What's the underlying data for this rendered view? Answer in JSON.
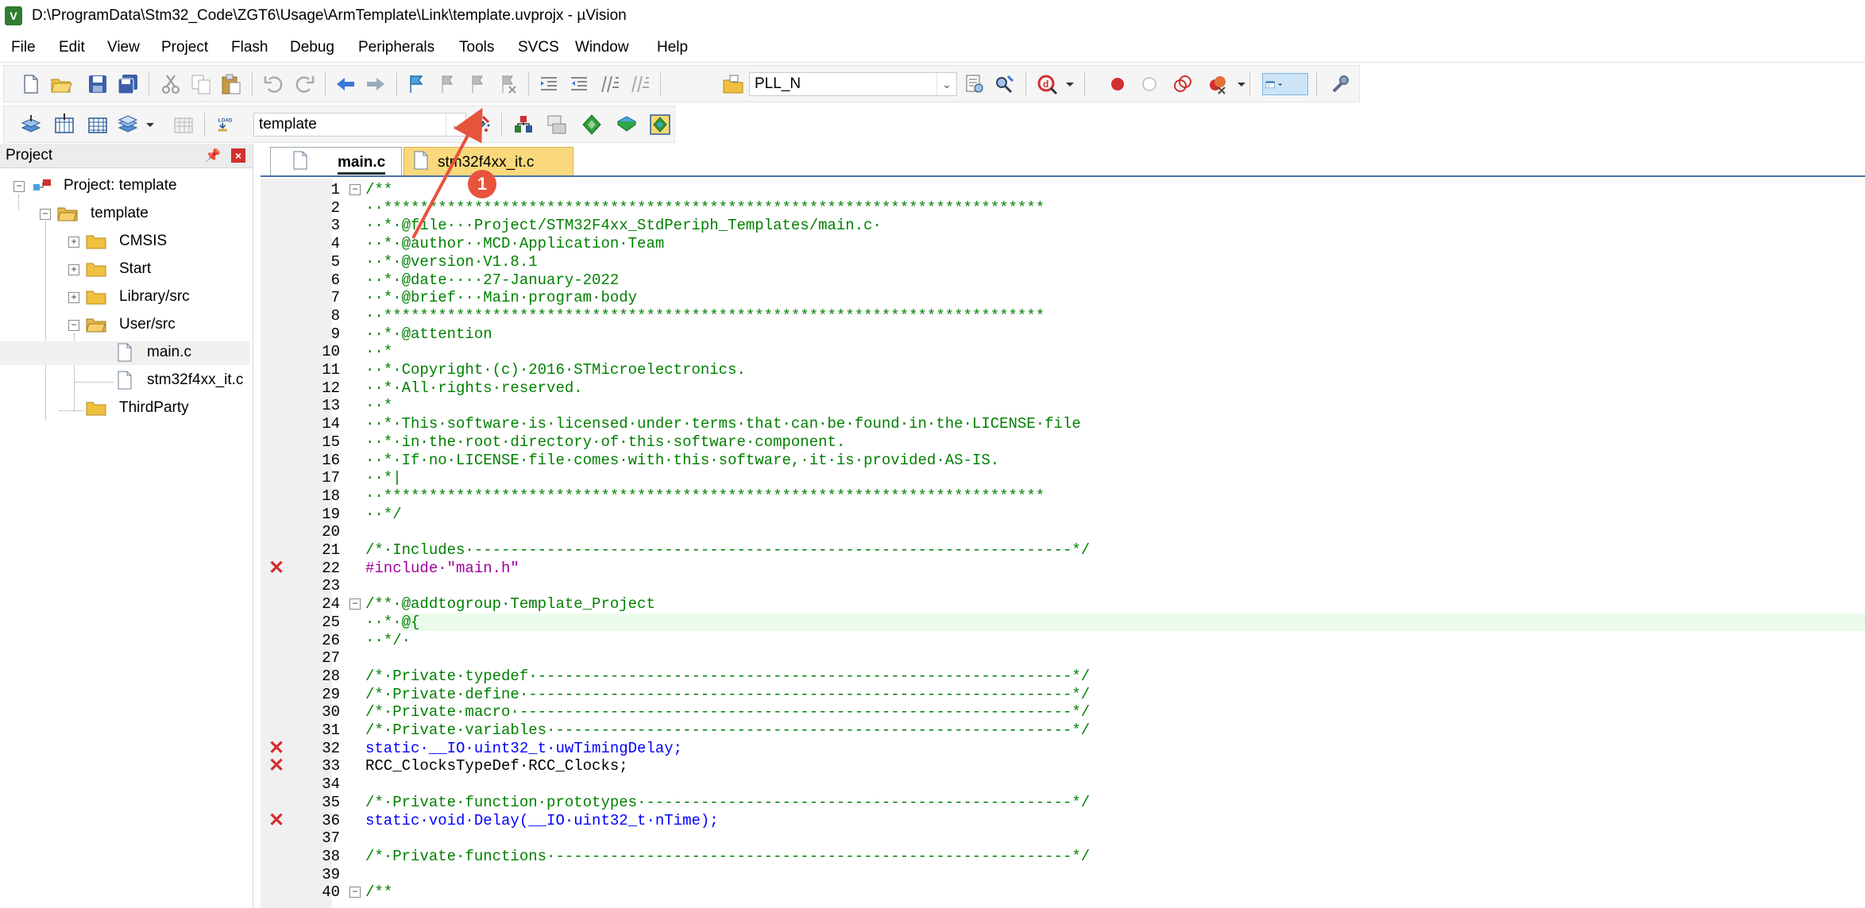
{
  "window": {
    "title": "D:\\ProgramData\\Stm32_Code\\ZGT6\\Usage\\ArmTemplate\\Link\\template.uvprojx - µVision",
    "app_icon": "V"
  },
  "menu": [
    "File",
    "Edit",
    "View",
    "Project",
    "Flash",
    "Debug",
    "Peripherals",
    "Tools",
    "SVCS",
    "Window",
    "Help"
  ],
  "toolbar1": {
    "find_combo_value": "PLL_N",
    "icons": [
      "new-file-icon",
      "open-icon",
      "save-icon",
      "save-all-icon",
      "cut-icon",
      "copy-icon",
      "paste-icon",
      "undo-icon",
      "redo-icon",
      "back-icon",
      "forward-icon",
      "bookmark-icon",
      "prev-bookmark-icon",
      "next-bookmark-icon",
      "clear-bookmarks-icon",
      "indent-icon",
      "unindent-icon",
      "comment-icon",
      "uncomment-icon",
      "find-in-files-icon",
      "find-icon",
      "incremental-find-icon",
      "debug-start-icon",
      "breakpoint-icon",
      "disable-breakpoint-icon",
      "disable-all-breakpoints-icon",
      "kill-breakpoints-icon",
      "window-layout-icon",
      "configure-icon"
    ]
  },
  "toolbar2": {
    "target_combo_value": "template",
    "load_label": "LOAD",
    "icons": [
      "translate-icon",
      "build-icon",
      "rebuild-icon",
      "batch-build-icon",
      "stop-build-icon",
      "download-icon",
      "options-for-target-icon",
      "manage-project-items-icon",
      "select-packs-icon",
      "pack-installer-icon",
      "manage-rte-icon",
      "event-recorder-icon"
    ]
  },
  "project_pane": {
    "title": "Project",
    "tree": [
      {
        "label": "Project: template",
        "level": 0,
        "type": "project",
        "expand": "−"
      },
      {
        "label": "template",
        "level": 1,
        "type": "target",
        "expand": "−"
      },
      {
        "label": "CMSIS",
        "level": 2,
        "type": "folder",
        "expand": "+"
      },
      {
        "label": "Start",
        "level": 2,
        "type": "folder",
        "expand": "+"
      },
      {
        "label": "Library/src",
        "level": 2,
        "type": "folder",
        "expand": "+"
      },
      {
        "label": "User/src",
        "level": 2,
        "type": "folder",
        "expand": "−"
      },
      {
        "label": "main.c",
        "level": 3,
        "type": "file",
        "expand": ""
      },
      {
        "label": "stm32f4xx_it.c",
        "level": 3,
        "type": "file",
        "expand": ""
      },
      {
        "label": "ThirdParty",
        "level": 2,
        "type": "folder",
        "expand": ""
      }
    ]
  },
  "tabs": [
    {
      "label": "main.c",
      "active": true
    },
    {
      "label": "stm32f4xx_it.c",
      "active": false
    }
  ],
  "callout": {
    "number": "1",
    "points_to": "options-for-target-icon"
  },
  "code_lines": [
    {
      "n": "1",
      "text": "/**",
      "kind": "comment",
      "fold": "−",
      "err": false
    },
    {
      "n": "2",
      "text": "··*************************************************************************",
      "kind": "comment",
      "fold": "",
      "err": false
    },
    {
      "n": "3",
      "text": "··*·@file···Project/STM32F4xx_StdPeriph_Templates/main.c·",
      "kind": "comment",
      "fold": "",
      "err": false
    },
    {
      "n": "4",
      "text": "··*·@author··MCD·Application·Team",
      "kind": "comment",
      "fold": "",
      "err": false
    },
    {
      "n": "5",
      "text": "··*·@version·V1.8.1",
      "kind": "comment",
      "fold": "",
      "err": false
    },
    {
      "n": "6",
      "text": "··*·@date····27-January-2022",
      "kind": "comment",
      "fold": "",
      "err": false
    },
    {
      "n": "7",
      "text": "··*·@brief···Main·program·body",
      "kind": "comment",
      "fold": "",
      "err": false
    },
    {
      "n": "8",
      "text": "··*************************************************************************",
      "kind": "comment",
      "fold": "",
      "err": false
    },
    {
      "n": "9",
      "text": "··*·@attention",
      "kind": "comment",
      "fold": "",
      "err": false
    },
    {
      "n": "10",
      "text": "··*",
      "kind": "comment",
      "fold": "",
      "err": false
    },
    {
      "n": "11",
      "text": "··*·Copyright·(c)·2016·STMicroelectronics.",
      "kind": "comment",
      "fold": "",
      "err": false
    },
    {
      "n": "12",
      "text": "··*·All·rights·reserved.",
      "kind": "comment",
      "fold": "",
      "err": false
    },
    {
      "n": "13",
      "text": "··*",
      "kind": "comment",
      "fold": "",
      "err": false
    },
    {
      "n": "14",
      "text": "··*·This·software·is·licensed·under·terms·that·can·be·found·in·the·LICENSE·file",
      "kind": "comment",
      "fold": "",
      "err": false
    },
    {
      "n": "15",
      "text": "··*·in·the·root·directory·of·this·software·component.",
      "kind": "comment",
      "fold": "",
      "err": false
    },
    {
      "n": "16",
      "text": "··*·If·no·LICENSE·file·comes·with·this·software,·it·is·provided·AS-IS.",
      "kind": "comment",
      "fold": "",
      "err": false
    },
    {
      "n": "17",
      "text": "··*|",
      "kind": "comment",
      "fold": "",
      "err": false
    },
    {
      "n": "18",
      "text": "··*************************************************************************",
      "kind": "comment",
      "fold": "",
      "err": false
    },
    {
      "n": "19",
      "text": "··*/",
      "kind": "comment",
      "fold": "",
      "err": false
    },
    {
      "n": "20",
      "text": "",
      "kind": "plain",
      "fold": "",
      "err": false
    },
    {
      "n": "21",
      "text": "/*·Includes·------------------------------------------------------------------*/",
      "kind": "comment",
      "fold": "",
      "err": false
    },
    {
      "n": "22",
      "text": "#include·\"main.h\"",
      "kind": "pp",
      "fold": "",
      "err": true
    },
    {
      "n": "23",
      "text": "",
      "kind": "plain",
      "fold": "",
      "err": false
    },
    {
      "n": "24",
      "text": "/**·@addtogroup·Template_Project",
      "kind": "comment",
      "fold": "−",
      "err": false
    },
    {
      "n": "25",
      "text": "··*·@{",
      "kind": "comment",
      "fold": "",
      "err": false
    },
    {
      "n": "26",
      "text": "··*/·",
      "kind": "comment",
      "fold": "",
      "err": false
    },
    {
      "n": "27",
      "text": "",
      "kind": "plain",
      "fold": "",
      "err": false
    },
    {
      "n": "28",
      "text": "/*·Private·typedef·-----------------------------------------------------------*/",
      "kind": "comment",
      "fold": "",
      "err": false
    },
    {
      "n": "29",
      "text": "/*·Private·define·------------------------------------------------------------*/",
      "kind": "comment",
      "fold": "",
      "err": false
    },
    {
      "n": "30",
      "text": "/*·Private·macro·-------------------------------------------------------------*/",
      "kind": "comment",
      "fold": "",
      "err": false
    },
    {
      "n": "31",
      "text": "/*·Private·variables·---------------------------------------------------------*/",
      "kind": "comment",
      "fold": "",
      "err": false
    },
    {
      "n": "32",
      "text": "static·__IO·uint32_t·uwTimingDelay;",
      "kind": "kw",
      "fold": "",
      "err": true
    },
    {
      "n": "33",
      "text": "RCC_ClocksTypeDef·RCC_Clocks;",
      "kind": "plain",
      "fold": "",
      "err": true
    },
    {
      "n": "34",
      "text": "",
      "kind": "plain",
      "fold": "",
      "err": false
    },
    {
      "n": "35",
      "text": "/*·Private·function·prototypes·-----------------------------------------------*/",
      "kind": "comment",
      "fold": "",
      "err": false
    },
    {
      "n": "36",
      "text": "static·void·Delay(__IO·uint32_t·nTime);",
      "kind": "kw",
      "fold": "",
      "err": true
    },
    {
      "n": "37",
      "text": "",
      "kind": "plain",
      "fold": "",
      "err": false
    },
    {
      "n": "38",
      "text": "/*·Private·functions·---------------------------------------------------------*/",
      "kind": "comment",
      "fold": "",
      "err": false
    },
    {
      "n": "39",
      "text": "",
      "kind": "plain",
      "fold": "",
      "err": false
    },
    {
      "n": "40",
      "text": "/**",
      "kind": "comment",
      "fold": "−",
      "err": false
    }
  ],
  "colors": {
    "comment": "#008000",
    "keyword": "#0000ff",
    "preprocessor": "#a000a0",
    "error": "#d32f2f",
    "callout": "#e8533c"
  }
}
